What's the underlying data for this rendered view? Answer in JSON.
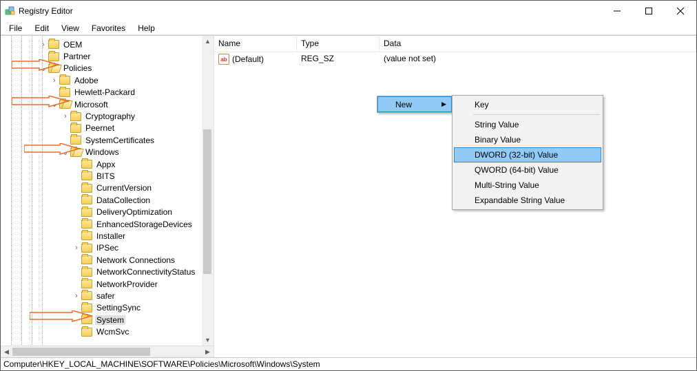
{
  "window": {
    "title": "Registry Editor"
  },
  "menubar": [
    "File",
    "Edit",
    "View",
    "Favorites",
    "Help"
  ],
  "tree": [
    {
      "depth": 3,
      "expand": ">",
      "open": false,
      "label": "OEM",
      "sel": false
    },
    {
      "depth": 3,
      "expand": "",
      "open": false,
      "label": "Partner",
      "sel": false
    },
    {
      "depth": 3,
      "expand": "v",
      "open": true,
      "label": "Policies",
      "sel": false
    },
    {
      "depth": 4,
      "expand": ">",
      "open": false,
      "label": "Adobe",
      "sel": false
    },
    {
      "depth": 4,
      "expand": "",
      "open": false,
      "label": "Hewlett-Packard",
      "sel": false
    },
    {
      "depth": 4,
      "expand": "v",
      "open": true,
      "label": "Microsoft",
      "sel": false
    },
    {
      "depth": 5,
      "expand": ">",
      "open": false,
      "label": "Cryptography",
      "sel": false
    },
    {
      "depth": 5,
      "expand": "",
      "open": false,
      "label": "Peernet",
      "sel": false
    },
    {
      "depth": 5,
      "expand": "",
      "open": false,
      "label": "SystemCertificates",
      "sel": false
    },
    {
      "depth": 5,
      "expand": "v",
      "open": true,
      "label": "Windows",
      "sel": false
    },
    {
      "depth": 6,
      "expand": "",
      "open": false,
      "label": "Appx",
      "sel": false
    },
    {
      "depth": 6,
      "expand": "",
      "open": false,
      "label": "BITS",
      "sel": false
    },
    {
      "depth": 6,
      "expand": "",
      "open": false,
      "label": "CurrentVersion",
      "sel": false
    },
    {
      "depth": 6,
      "expand": "",
      "open": false,
      "label": "DataCollection",
      "sel": false
    },
    {
      "depth": 6,
      "expand": "",
      "open": false,
      "label": "DeliveryOptimization",
      "sel": false
    },
    {
      "depth": 6,
      "expand": "",
      "open": false,
      "label": "EnhancedStorageDevices",
      "sel": false
    },
    {
      "depth": 6,
      "expand": "",
      "open": false,
      "label": "Installer",
      "sel": false
    },
    {
      "depth": 6,
      "expand": ">",
      "open": false,
      "label": "IPSec",
      "sel": false
    },
    {
      "depth": 6,
      "expand": "",
      "open": false,
      "label": "Network Connections",
      "sel": false
    },
    {
      "depth": 6,
      "expand": "",
      "open": false,
      "label": "NetworkConnectivityStatus",
      "sel": false
    },
    {
      "depth": 6,
      "expand": "",
      "open": false,
      "label": "NetworkProvider",
      "sel": false
    },
    {
      "depth": 6,
      "expand": ">",
      "open": false,
      "label": "safer",
      "sel": false
    },
    {
      "depth": 6,
      "expand": "",
      "open": false,
      "label": "SettingSync",
      "sel": false
    },
    {
      "depth": 6,
      "expand": "",
      "open": false,
      "label": "System",
      "sel": true
    },
    {
      "depth": 6,
      "expand": "",
      "open": false,
      "label": "WcmSvc",
      "sel": false
    }
  ],
  "list": {
    "columns": [
      "Name",
      "Type",
      "Data"
    ],
    "rows": [
      {
        "icon": "ab",
        "name": "(Default)",
        "type": "REG_SZ",
        "data": "(value not set)"
      }
    ]
  },
  "context": {
    "items": [
      {
        "label": "New",
        "sub": true
      }
    ],
    "sub": [
      "Key",
      "-",
      "String Value",
      "Binary Value",
      "DWORD (32-bit) Value",
      "QWORD (64-bit) Value",
      "Multi-String Value",
      "Expandable String Value"
    ],
    "highlighted_sub": "DWORD (32-bit) Value"
  },
  "statusbar": "Computer\\HKEY_LOCAL_MACHINE\\SOFTWARE\\Policies\\Microsoft\\Windows\\System"
}
